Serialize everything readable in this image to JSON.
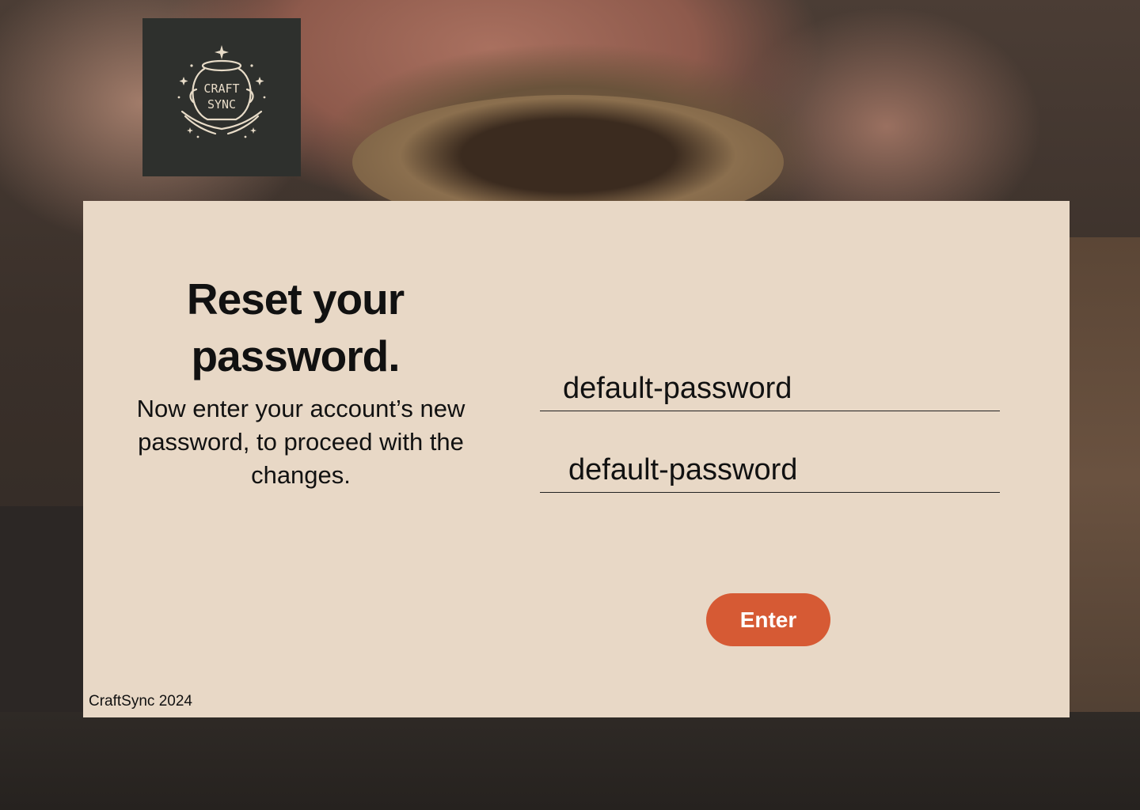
{
  "brand": {
    "logo_text_line1": "CRAFT",
    "logo_text_line2": "SYNC",
    "logo_icon": "pottery-jar-hands-icon"
  },
  "reset": {
    "title": "Reset your password.",
    "subtitle": "Now enter your account’s new password, to proceed with the changes.",
    "new_password_value": "default-password",
    "confirm_password_value": "default-password",
    "enter_label": "Enter"
  },
  "footer": {
    "text": "CraftSync 2024"
  },
  "colors": {
    "card_background": "#e8d8c6",
    "accent_button": "#d65a34",
    "logo_background": "#2e302d"
  }
}
